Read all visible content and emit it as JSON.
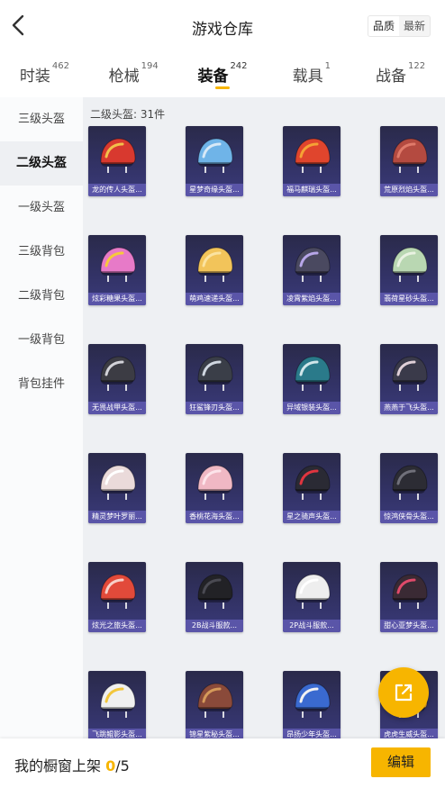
{
  "header": {
    "title": "游戏仓库",
    "sort_options": [
      "品质",
      "最新"
    ],
    "sort_selected": "品质"
  },
  "tabs": [
    {
      "label": "时装",
      "count": "462"
    },
    {
      "label": "枪械",
      "count": "194"
    },
    {
      "label": "装备",
      "count": "242",
      "active": true
    },
    {
      "label": "载具",
      "count": "1"
    },
    {
      "label": "战备",
      "count": "122"
    }
  ],
  "sidebar": {
    "items": [
      {
        "label": "三级头盔"
      },
      {
        "label": "二级头盔",
        "active": true
      },
      {
        "label": "一级头盔"
      },
      {
        "label": "三级背包"
      },
      {
        "label": "二级背包"
      },
      {
        "label": "一级背包"
      },
      {
        "label": "背包挂件"
      }
    ]
  },
  "main": {
    "section_label": "二级头盔: 31件",
    "items": [
      {
        "name": "龙的传人头盔...",
        "color": "#d8392f",
        "accent": "#f2c04a"
      },
      {
        "name": "星梦奇缘头盔...",
        "color": "#6fb4e8",
        "accent": "#d7e9f7"
      },
      {
        "name": "福马麒瑞头盔...",
        "color": "#e0452d",
        "accent": "#f5a235"
      },
      {
        "name": "荒原烈焰头盔...",
        "color": "#b44a40",
        "accent": "#e07a6a"
      },
      {
        "name": "炫彩糖果头盔...",
        "color": "#e77ac8",
        "accent": "#f6c93b"
      },
      {
        "name": "萌鸡速递头盔...",
        "color": "#f2c45a",
        "accent": "#fbe3a0"
      },
      {
        "name": "凌霄紫焰头盔...",
        "color": "#4a4960",
        "accent": "#b7a6e8"
      },
      {
        "name": "翡荷星砂头盔...",
        "color": "#b9d7b2",
        "accent": "#e9f2e2"
      },
      {
        "name": "无畏战甲头盔...",
        "color": "#3c3c44",
        "accent": "#d2d2d8"
      },
      {
        "name": "狂鲨锋刃头盔...",
        "color": "#3a3e48",
        "accent": "#cfd6e0"
      },
      {
        "name": "异域银装头盔...",
        "color": "#2a7a8a",
        "accent": "#d0e6ea"
      },
      {
        "name": "燕燕于飞头盔...",
        "color": "#3a3a4a",
        "accent": "#e0d0d8"
      },
      {
        "name": "精灵梦叶罗丽...",
        "color": "#eadada",
        "accent": "#ffffff"
      },
      {
        "name": "香桃花海头盔...",
        "color": "#f0b8c4",
        "accent": "#fde4ea"
      },
      {
        "name": "星之骑声头盔...",
        "color": "#2a2a34",
        "accent": "#e0353f"
      },
      {
        "name": "惊鸿侠骨头盔...",
        "color": "#2c2c34",
        "accent": "#70707a"
      },
      {
        "name": "炫光之旅头盔...",
        "color": "#e24a3a",
        "accent": "#f7d0c8"
      },
      {
        "name": "2B战斗服款...",
        "color": "#222226",
        "accent": "#4a4a52"
      },
      {
        "name": "2P战斗服款...",
        "color": "#eeeeee",
        "accent": "#ffffff"
      },
      {
        "name": "甜心亚梦头盔...",
        "color": "#3a2a34",
        "accent": "#e04a6a"
      },
      {
        "name": "飞跳鲲影头盔...",
        "color": "#f0f0f0",
        "accent": "#f2c63a"
      },
      {
        "name": "锦星紫秘头盔...",
        "color": "#8a4a3a",
        "accent": "#d59a5a"
      },
      {
        "name": "昂扬少年头盔...",
        "color": "#3a6ad0",
        "accent": "#f2f2f2"
      },
      {
        "name": "虎虎生威头盔...",
        "color": "#e2a03a",
        "accent": "#f5d08a"
      }
    ]
  },
  "fab": {
    "icon": "share-icon"
  },
  "bottom": {
    "shelf_label": "我的橱窗上架",
    "shelf_count": "0",
    "shelf_total": "/5",
    "edit_label": "编辑"
  },
  "colors": {
    "accent": "#f7b500",
    "card_caption": "#5a55a8",
    "card_bg": "#323265"
  }
}
